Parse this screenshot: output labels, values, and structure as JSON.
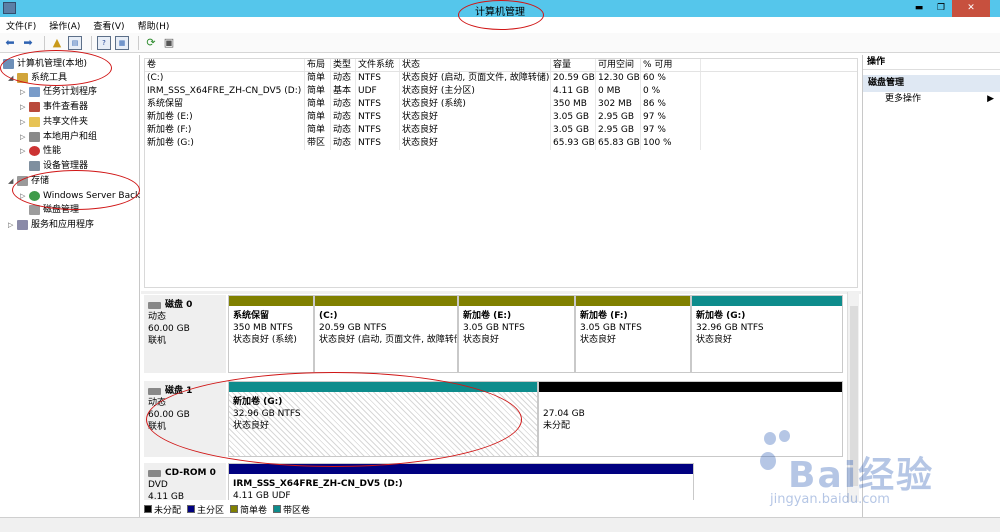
{
  "window": {
    "title": "计算机管理"
  },
  "menu": [
    "文件(F)",
    "操作(A)",
    "查看(V)",
    "帮助(H)"
  ],
  "toolbar_icons": [
    "back-icon",
    "forward-icon",
    "up-icon",
    "show-hide-tree-icon",
    "help-icon",
    "properties-icon",
    "export-icon",
    "refresh-icon"
  ],
  "tree": {
    "root": "计算机管理(本地)",
    "system_tools": "系统工具",
    "task_scheduler": "任务计划程序",
    "event_viewer": "事件查看器",
    "shared_folders": "共享文件夹",
    "local_users": "本地用户和组",
    "performance": "性能",
    "device_manager": "设备管理器",
    "storage": "存储",
    "windows_server_backup": "Windows Server Back",
    "disk_management": "磁盘管理",
    "services_apps": "服务和应用程序"
  },
  "volume_table": {
    "headers": [
      "卷",
      "布局",
      "类型",
      "文件系统",
      "状态",
      "容量",
      "可用空间",
      "% 可用"
    ],
    "rows": [
      [
        "(C:)",
        "简单",
        "动态",
        "NTFS",
        "状态良好 (启动, 页面文件, 故障转储)",
        "20.59 GB",
        "12.30 GB",
        "60 %"
      ],
      [
        "IRM_SSS_X64FRE_ZH-CN_DV5 (D:)",
        "简单",
        "基本",
        "UDF",
        "状态良好 (主分区)",
        "4.11 GB",
        "0 MB",
        "0 %"
      ],
      [
        "系统保留",
        "简单",
        "动态",
        "NTFS",
        "状态良好 (系统)",
        "350 MB",
        "302 MB",
        "86 %"
      ],
      [
        "新加卷 (E:)",
        "简单",
        "动态",
        "NTFS",
        "状态良好",
        "3.05 GB",
        "2.95 GB",
        "97 %"
      ],
      [
        "新加卷 (F:)",
        "简单",
        "动态",
        "NTFS",
        "状态良好",
        "3.05 GB",
        "2.95 GB",
        "97 %"
      ],
      [
        "新加卷 (G:)",
        "带区",
        "动态",
        "NTFS",
        "状态良好",
        "65.93 GB",
        "65.83 GB",
        "100 %"
      ]
    ]
  },
  "disks": {
    "disk0": {
      "name": "磁盘 0",
      "type": "动态",
      "size": "60.00 GB",
      "status": "联机"
    },
    "disk1": {
      "name": "磁盘 1",
      "type": "动态",
      "size": "60.00 GB",
      "status": "联机"
    },
    "cdrom0": {
      "name": "CD-ROM 0",
      "type": "DVD",
      "size": "4.11 GB"
    }
  },
  "partitions": {
    "p_sys": {
      "name": "系统保留",
      "size": "350 MB NTFS",
      "status": "状态良好 (系统)"
    },
    "p_c": {
      "name": "(C:)",
      "size": "20.59 GB NTFS",
      "status": "状态良好 (启动, 页面文件, 故障转储"
    },
    "p_e": {
      "name": "新加卷 (E:)",
      "size": "3.05 GB NTFS",
      "status": "状态良好"
    },
    "p_f": {
      "name": "新加卷 (F:)",
      "size": "3.05 GB NTFS",
      "status": "状态良好"
    },
    "p_g0": {
      "name": "新加卷 (G:)",
      "size": "32.96 GB NTFS",
      "status": "状态良好"
    },
    "p_g1": {
      "name": "新加卷 (G:)",
      "size": "32.96 GB NTFS",
      "status": "状态良好"
    },
    "p_unalloc": {
      "size": "27.04 GB",
      "status": "未分配"
    },
    "p_d": {
      "name": "IRM_SSS_X64FRE_ZH-CN_DV5 (D:)",
      "size": "4.11 GB UDF"
    }
  },
  "legend": [
    "未分配",
    "主分区",
    "简单卷",
    "带区卷"
  ],
  "actions": {
    "header": "操作",
    "section": "磁盘管理",
    "more": "更多操作"
  },
  "watermark": {
    "brand": "Bai经验",
    "url": "jingyan.baidu.com"
  },
  "colors": {
    "titlebar": "#55c6eb",
    "simple": "#808000",
    "striped": "#0e8c8c",
    "primary": "#000080",
    "unallocated": "#000000",
    "annotation": "#d01616"
  }
}
